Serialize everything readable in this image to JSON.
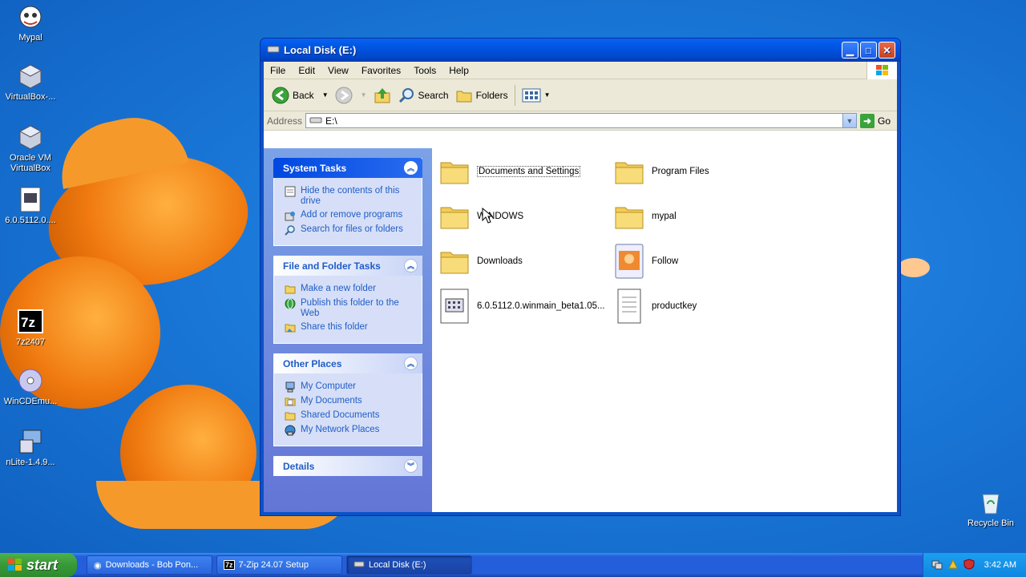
{
  "desktop": {
    "icons": [
      {
        "label": "Mypal"
      },
      {
        "label": "VirtualBox-..."
      },
      {
        "label": "Oracle VM VirtualBox"
      },
      {
        "label": "6.0.5112.0...."
      },
      {
        "label": "7z2407"
      },
      {
        "label": "WinCDEmu..."
      },
      {
        "label": "nLite-1.4.9..."
      },
      {
        "label": "Recycle Bin"
      }
    ]
  },
  "window": {
    "title": "Local Disk (E:)",
    "menu": [
      "File",
      "Edit",
      "View",
      "Favorites",
      "Tools",
      "Help"
    ],
    "toolbar": {
      "back": "Back",
      "search": "Search",
      "folders": "Folders"
    },
    "address": {
      "label": "Address",
      "value": "E:\\",
      "go": "Go"
    },
    "panels": {
      "system_tasks": {
        "title": "System Tasks",
        "items": [
          "Hide the contents of this drive",
          "Add or remove programs",
          "Search for files or folders"
        ]
      },
      "file_folder_tasks": {
        "title": "File and Folder Tasks",
        "items": [
          "Make a new folder",
          "Publish this folder to the Web",
          "Share this folder"
        ]
      },
      "other_places": {
        "title": "Other Places",
        "items": [
          "My Computer",
          "My Documents",
          "Shared Documents",
          "My Network Places"
        ]
      },
      "details": {
        "title": "Details"
      }
    },
    "files": [
      {
        "name": "Documents and Settings",
        "type": "folder"
      },
      {
        "name": "Program Files",
        "type": "folder"
      },
      {
        "name": "WINDOWS",
        "type": "folder"
      },
      {
        "name": "mypal",
        "type": "folder"
      },
      {
        "name": "Downloads",
        "type": "folder"
      },
      {
        "name": "Follow",
        "type": "image"
      },
      {
        "name": "6.0.5112.0.winmain_beta1.05...",
        "type": "disc-image"
      },
      {
        "name": "productkey",
        "type": "text"
      }
    ]
  },
  "taskbar": {
    "start": "start",
    "tasks": [
      {
        "label": "Downloads - Bob Pon..."
      },
      {
        "label": "7-Zip 24.07 Setup"
      },
      {
        "label": "Local Disk (E:)"
      }
    ],
    "clock": "3:42 AM"
  }
}
